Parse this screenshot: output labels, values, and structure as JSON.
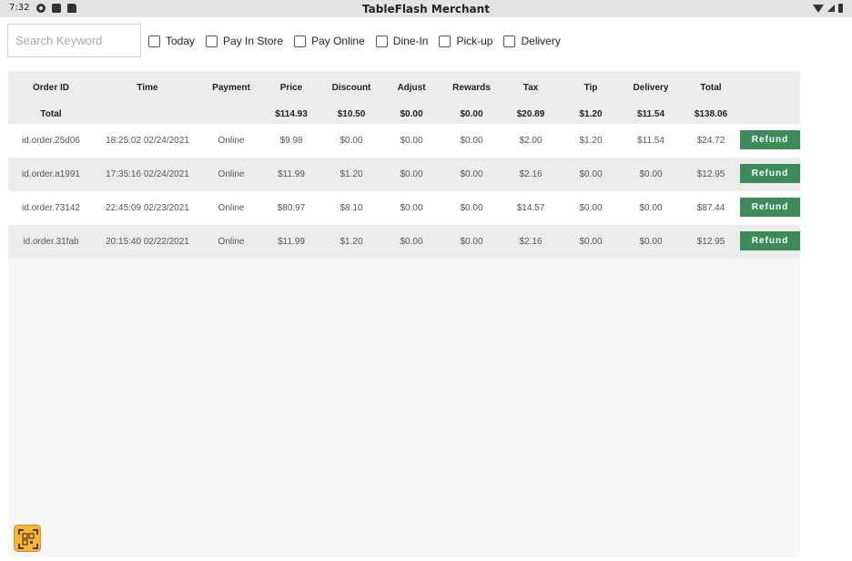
{
  "status": {
    "time": "7:32",
    "icons_left": [
      "gear-icon",
      "photo-icon",
      "sd-card-icon"
    ],
    "icons_right": [
      "wifi-icon",
      "signal-icon",
      "battery-icon"
    ]
  },
  "app": {
    "title": "TableFlash Merchant"
  },
  "search": {
    "placeholder": "Search Keyword",
    "value": ""
  },
  "filters": [
    {
      "label": "Today",
      "checked": false
    },
    {
      "label": "Pay In Store",
      "checked": false
    },
    {
      "label": "Pay Online",
      "checked": false
    },
    {
      "label": "Dine-In",
      "checked": false
    },
    {
      "label": "Pick-up",
      "checked": false
    },
    {
      "label": "Delivery",
      "checked": false
    }
  ],
  "table": {
    "headers": [
      "Order ID",
      "Time",
      "Payment",
      "Price",
      "Discount",
      "Adjust",
      "Rewards",
      "Tax",
      "Tip",
      "Delivery",
      "Total"
    ],
    "totals": [
      "Total",
      "",
      "",
      "$114.93",
      "$10.50",
      "$0.00",
      "$0.00",
      "$20.89",
      "$1.20",
      "$11.54",
      "$138.06"
    ],
    "refund_label": "Refund",
    "rows": [
      [
        "id.order.25d06",
        "18:25:02 02/24/2021",
        "Online",
        "$9.98",
        "$0.00",
        "$0.00",
        "$0.00",
        "$2.00",
        "$1.20",
        "$11.54",
        "$24.72"
      ],
      [
        "id.order.a1991",
        "17:35:16 02/24/2021",
        "Online",
        "$11.99",
        "$1.20",
        "$0.00",
        "$0.00",
        "$2.16",
        "$0.00",
        "$0.00",
        "$12.95"
      ],
      [
        "id.order.73142",
        "22:45:09 02/23/2021",
        "Online",
        "$80.97",
        "$8.10",
        "$0.00",
        "$0.00",
        "$14.57",
        "$0.00",
        "$0.00",
        "$87.44"
      ],
      [
        "id.order.31fab",
        "20:15:40 02/22/2021",
        "Online",
        "$11.99",
        "$1.20",
        "$0.00",
        "$0.00",
        "$2.16",
        "$0.00",
        "$0.00",
        "$12.95"
      ]
    ]
  },
  "fab": {
    "icon": "qr-scan-icon"
  },
  "colors": {
    "accent": "#3d8b5a",
    "fab": "#f3b53c"
  }
}
